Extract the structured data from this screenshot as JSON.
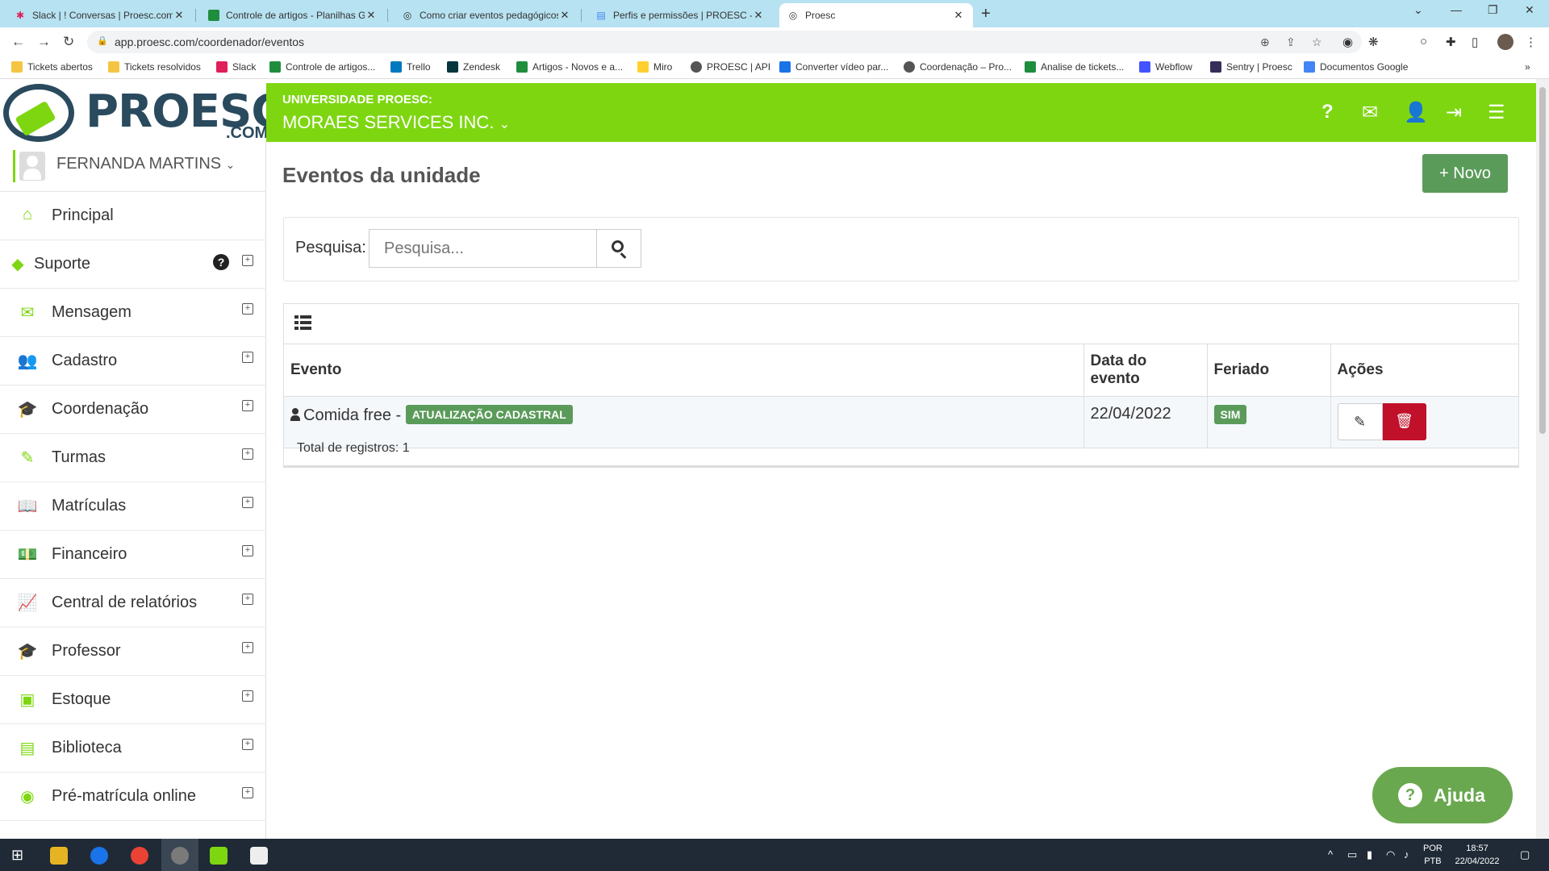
{
  "browser": {
    "tabs": [
      {
        "title": "Slack | ! Conversas | Proesc.com |",
        "active": false
      },
      {
        "title": "Controle de artigos - Planilhas Go",
        "active": false
      },
      {
        "title": "Como criar eventos pedagógicos",
        "active": false
      },
      {
        "title": "Perfis e permissões | PROESC - D",
        "active": false
      },
      {
        "title": "Proesc",
        "active": true
      }
    ],
    "url": "app.proesc.com/coordenador/eventos",
    "bookmarks": [
      {
        "label": "Tickets abertos",
        "color": "#f4c542"
      },
      {
        "label": "Tickets resolvidos",
        "color": "#f4c542"
      },
      {
        "label": "Slack",
        "color": "#e01e5a"
      },
      {
        "label": "Controle de artigos...",
        "color": "#1e8e3e"
      },
      {
        "label": "Trello",
        "color": "#0079bf"
      },
      {
        "label": "Zendesk",
        "color": "#03363d"
      },
      {
        "label": "Artigos - Novos e a...",
        "color": "#1e8e3e"
      },
      {
        "label": "Miro",
        "color": "#ffd02f"
      },
      {
        "label": "PROESC | API",
        "color": "#555555"
      },
      {
        "label": "Converter vídeo par...",
        "color": "#1a73e8"
      },
      {
        "label": "Coordenação – Pro...",
        "color": "#555555"
      },
      {
        "label": "Analise de tickets...",
        "color": "#1e8e3e"
      },
      {
        "label": "Webflow",
        "color": "#4353ff"
      },
      {
        "label": "Sentry | Proesc",
        "color": "#362d59"
      },
      {
        "label": "Documentos Google",
        "color": "#4285f4"
      }
    ]
  },
  "header": {
    "logo_text": "PROESC",
    "logo_suffix": ".COM",
    "institution_label": "UNIVERSIDADE PROESC:",
    "organization": "MORAES SERVICES INC.",
    "accent_color": "#7ed611"
  },
  "sidebar": {
    "user_name": "FERNANDA MARTINS",
    "items": [
      {
        "label": "Principal",
        "icon": "home-icon",
        "glyph": "⌂",
        "expandable": false
      },
      {
        "label": "Suporte",
        "icon": "support-icon",
        "glyph": "◆",
        "expandable": true,
        "help": "?"
      },
      {
        "label": "Mensagem",
        "icon": "envelope-icon",
        "glyph": "✉",
        "expandable": true
      },
      {
        "label": "Cadastro",
        "icon": "users-icon",
        "glyph": "👥",
        "expandable": true
      },
      {
        "label": "Coordenação",
        "icon": "graduation-cap-icon",
        "glyph": "🎓",
        "expandable": true
      },
      {
        "label": "Turmas",
        "icon": "pencil-icon",
        "glyph": "✎",
        "expandable": true
      },
      {
        "label": "Matrículas",
        "icon": "book-icon",
        "glyph": "📖",
        "expandable": true
      },
      {
        "label": "Financeiro",
        "icon": "money-icon",
        "glyph": "💵",
        "expandable": true
      },
      {
        "label": "Central de relatórios",
        "icon": "line-chart-icon",
        "glyph": "📈",
        "expandable": true
      },
      {
        "label": "Professor",
        "icon": "graduation-cap-icon",
        "glyph": "🎓",
        "expandable": true
      },
      {
        "label": "Estoque",
        "icon": "cube-icon",
        "glyph": "▣",
        "expandable": true
      },
      {
        "label": "Biblioteca",
        "icon": "archive-icon",
        "glyph": "▤",
        "expandable": true
      },
      {
        "label": "Pré-matrícula online",
        "icon": "globe-icon",
        "glyph": "◉",
        "expandable": true
      }
    ]
  },
  "main": {
    "title": "Eventos da unidade",
    "new_button": "+ Novo",
    "search": {
      "label": "Pesquisa:",
      "placeholder": "Pesquisa..."
    },
    "table": {
      "headers": [
        "Evento",
        "Data do evento",
        "Feriado",
        "Ações"
      ],
      "rows": [
        {
          "event": "Comida free -",
          "tag": "ATUALIZAÇÃO CADASTRAL",
          "date": "22/04/2022",
          "holiday": "SIM"
        }
      ],
      "total": "Total de registros: 1"
    }
  },
  "help_button": "Ajuda",
  "taskbar": {
    "language": "POR",
    "layout": "PTB",
    "time": "18:57",
    "date": "22/04/2022"
  }
}
